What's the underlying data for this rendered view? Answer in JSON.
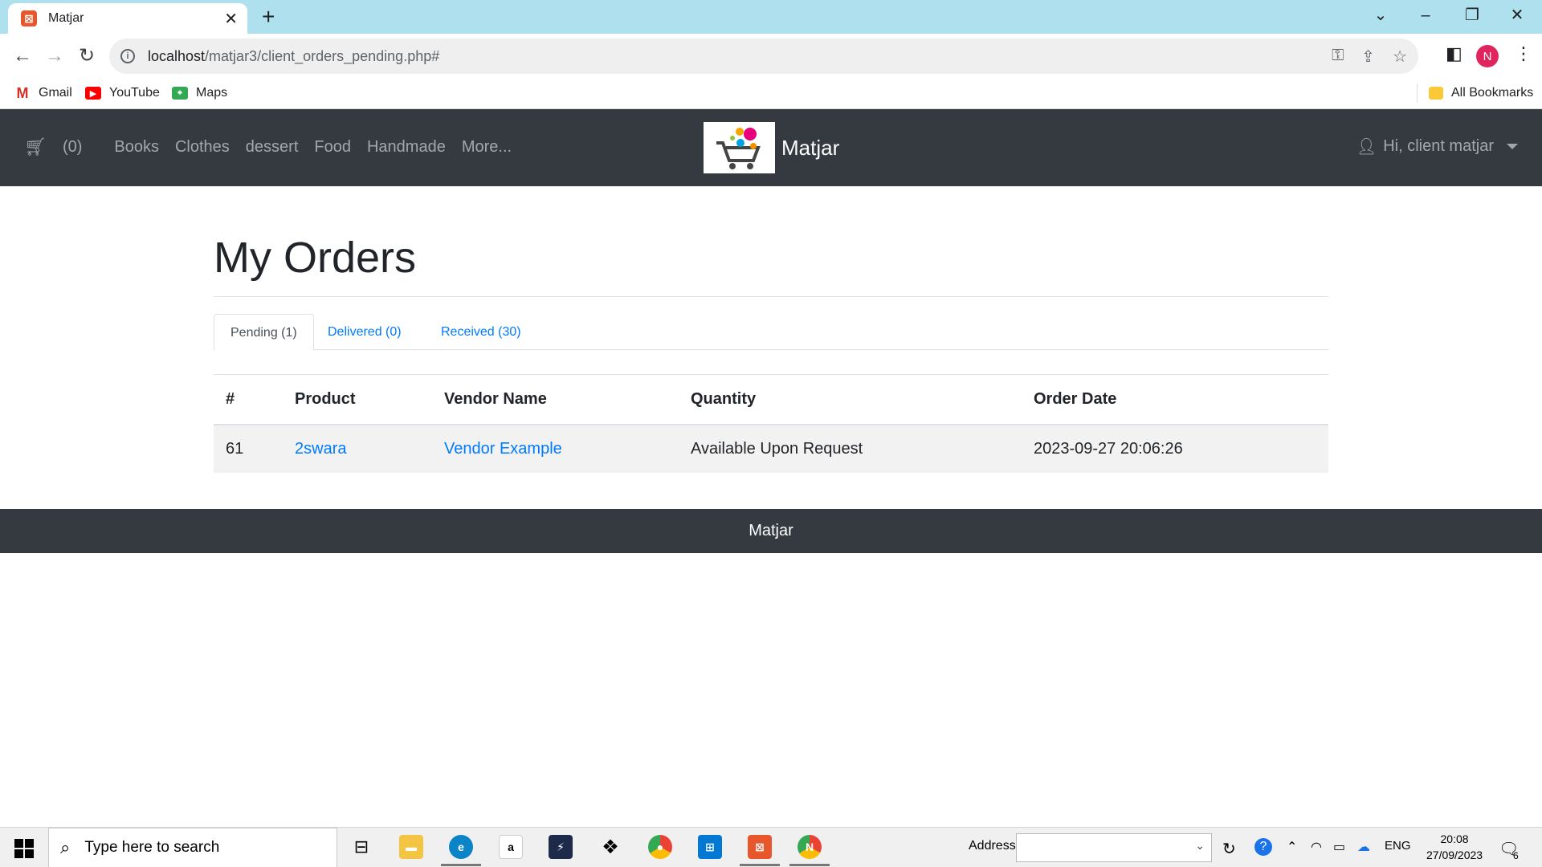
{
  "browser": {
    "tab_title": "Matjar",
    "url_host": "localhost",
    "url_path": "/matjar3/client_orders_pending.php#",
    "bookmarks": [
      "Gmail",
      "YouTube",
      "Maps"
    ],
    "all_bookmarks": "All Bookmarks",
    "profile_initial": "N"
  },
  "site": {
    "cart_label": "(0)",
    "nav_items": [
      "Books",
      "Clothes",
      "dessert",
      "Food",
      "Handmade",
      "More..."
    ],
    "brand": "Matjar",
    "user_greeting": "Hi, client matjar"
  },
  "page": {
    "title": "My Orders",
    "tabs": [
      {
        "label": "Pending (1)",
        "active": true
      },
      {
        "label": "Delivered (0)",
        "active": false
      },
      {
        "label": "Received (30)",
        "active": false
      }
    ],
    "table": {
      "headers": [
        "#",
        "Product",
        "Vendor Name",
        "Quantity",
        "Order Date"
      ],
      "rows": [
        {
          "id": "61",
          "product": "2swara",
          "vendor": "Vendor Example",
          "quantity": "Available Upon Request",
          "date": "2023-09-27 20:06:26"
        }
      ]
    }
  },
  "footer": {
    "text": "Matjar"
  },
  "taskbar": {
    "search_placeholder": "Type here to search",
    "address_label": "Address",
    "language": "ENG",
    "time": "20:08",
    "date": "27/09/2023",
    "notification_count": "6"
  },
  "colors": {
    "navbar_bg": "#343a40",
    "link": "#007bff",
    "tabbar_bg": "#aee0ee"
  }
}
